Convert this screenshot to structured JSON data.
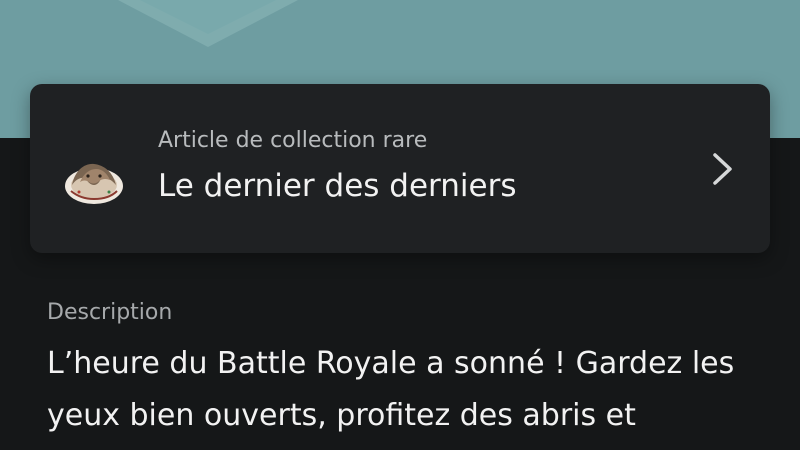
{
  "hero": {
    "background_color": "#6e9da1",
    "icon": "chevron-down-icon"
  },
  "trophy": {
    "category": "Article de collection rare",
    "title": "Le dernier des derniers",
    "thumbnail_icon": "trophy-artwork-icon",
    "open_icon": "chevron-right-icon"
  },
  "description": {
    "label": "Description",
    "text": "L’heure du Battle Royale a sonné ! Gardez les yeux bien ouverts, profitez des abris et"
  }
}
